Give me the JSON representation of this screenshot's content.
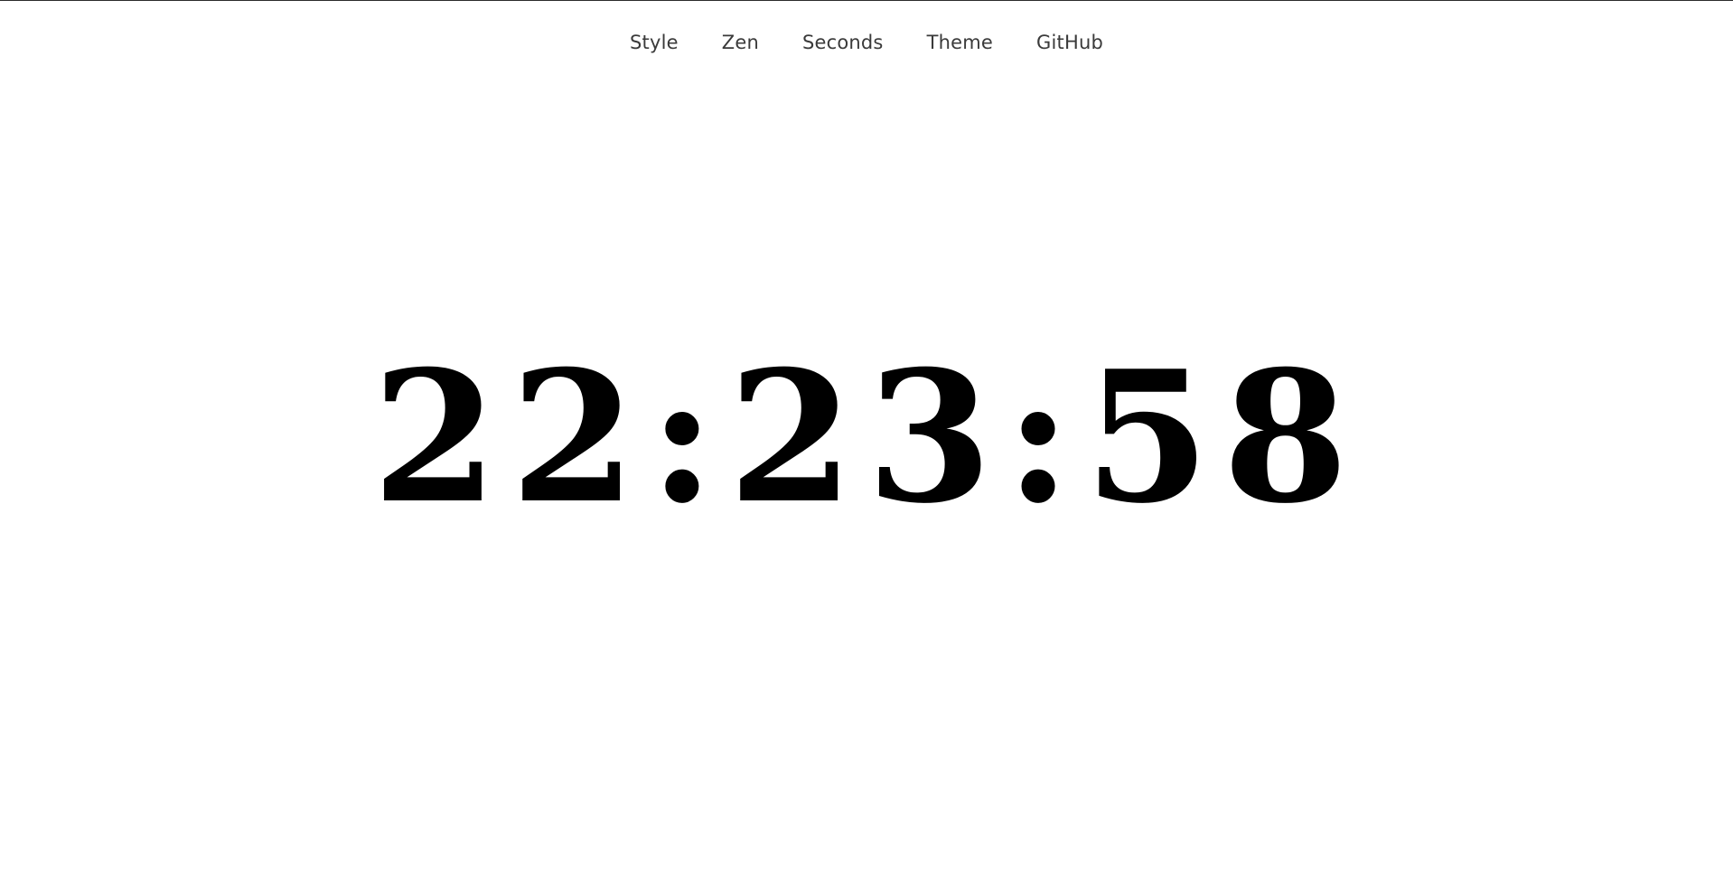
{
  "nav": {
    "items": [
      {
        "label": "Style"
      },
      {
        "label": "Zen"
      },
      {
        "label": "Seconds"
      },
      {
        "label": "Theme"
      },
      {
        "label": "GitHub"
      }
    ]
  },
  "clock": {
    "time": "22:23:58"
  },
  "colors": {
    "background": "#ffffff",
    "text": "#000000",
    "nav_text": "#3a3a3a"
  }
}
